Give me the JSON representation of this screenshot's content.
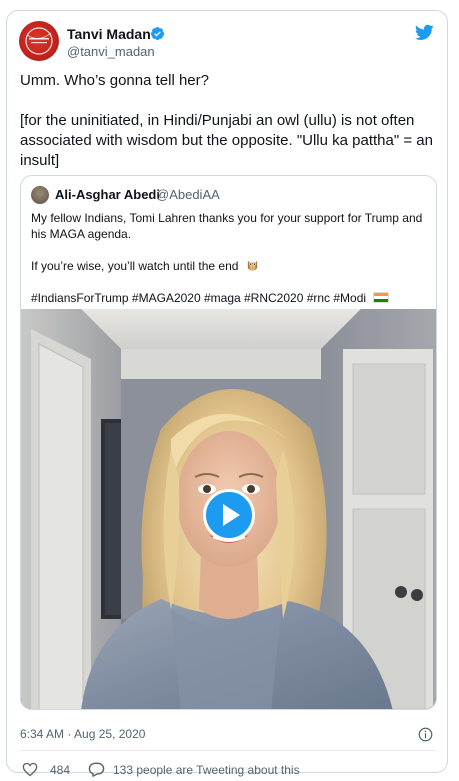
{
  "author": {
    "name": "Tanvi Madan",
    "handle": "@tanvi_madan",
    "verified": true
  },
  "tweet": {
    "line1": "Umm. Who’s gonna tell her?",
    "line2": "[for the uninitiated, in Hindi/Punjabi an owl (ullu) is not often associated with wisdom but the opposite. \"Ullu ka pattha\" = an insult]"
  },
  "quote": {
    "name": "Ali-Asghar Abedi",
    "handle": "@AbediAA",
    "line1": "My fellow Indians, Tomi Lahren thanks you for your support for Trump and his MAGA agenda.",
    "line2": "If you’re wise, you’ll watch until the end",
    "hashtags": "#IndiansForTrump #MAGA2020 #maga #RNC2020 #rnc #Modi"
  },
  "footer": {
    "timestamp": "6:34 AM · Aug 25, 2020",
    "likes": "484",
    "tweeting": "133 people are Tweeting about this"
  },
  "colors": {
    "accent": "#1d9bf0",
    "text": "#0f1419",
    "secondary": "#536471",
    "border": "#cfd9de"
  },
  "icons": [
    "twitter-bird-icon",
    "verified-badge-icon",
    "play-icon",
    "info-icon",
    "heart-icon",
    "reply-bubble-icon",
    "owl-emoji-icon",
    "india-flag-icon"
  ]
}
